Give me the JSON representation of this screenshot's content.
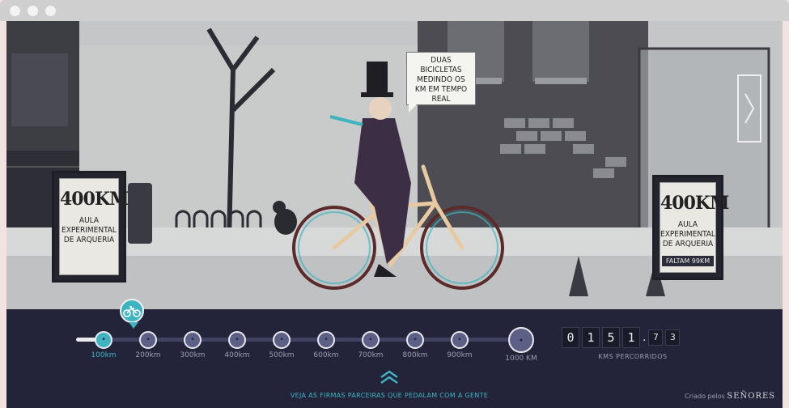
{
  "bubble": {
    "lines": [
      "DUAS",
      "BICICLETAS",
      "MEDINDO OS",
      "KM EM TEMPO",
      "REAL"
    ]
  },
  "sign_left": {
    "distance": "400KM",
    "lines": [
      "AULA",
      "EXPERIMENTAL",
      "DE ARQUERIA"
    ]
  },
  "sign_right": {
    "distance": "400KM",
    "lines": [
      "AULA",
      "EXPERIMENTAL",
      "DE ARQUERIA"
    ],
    "remaining": "FALTAM 99KM"
  },
  "progress": {
    "milestones": [
      {
        "label": "100km",
        "status": "reached"
      },
      {
        "label": "200km",
        "status": "pending"
      },
      {
        "label": "300km",
        "status": "pending"
      },
      {
        "label": "400km",
        "status": "pending"
      },
      {
        "label": "500km",
        "status": "pending"
      },
      {
        "label": "600km",
        "status": "pending"
      },
      {
        "label": "700km",
        "status": "pending"
      },
      {
        "label": "800km",
        "status": "pending"
      },
      {
        "label": "900km",
        "status": "pending"
      },
      {
        "label": "1000 KM",
        "status": "final"
      }
    ],
    "current_icon": "bicycle-icon",
    "milestone_icon": "trophy-icon",
    "fill_fraction": 0.1
  },
  "counter": {
    "digits": [
      "0",
      "1",
      "5",
      "1"
    ],
    "decimals": [
      "7",
      "3"
    ],
    "label": "KMS PERCORRIDOS"
  },
  "partners_link": "VEJA AS FIRMAS PARCEIRAS QUE PEDALAM COM A GENTE",
  "credit": {
    "prefix": "Criado pelos",
    "brand": "SEÑORES"
  },
  "colors": {
    "accent": "#3fb4c0",
    "bar_bg": "#23243a",
    "node": "#5c5f86"
  }
}
